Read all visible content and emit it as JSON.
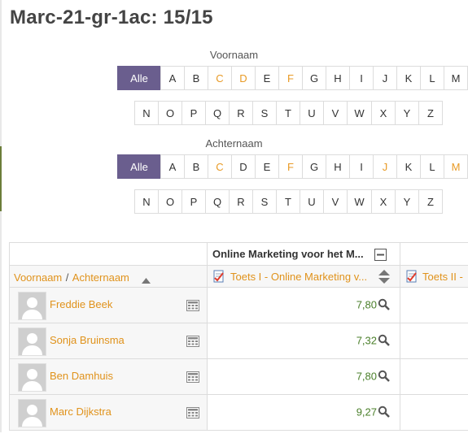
{
  "page": {
    "title": "Marc-21-gr-1ac: 15/15"
  },
  "filters": {
    "firstname_label": "Voornaam",
    "lastname_label": "Achternaam",
    "all_label": "Alle",
    "row1": [
      "A",
      "B",
      "C",
      "D",
      "E",
      "F",
      "G",
      "H",
      "I",
      "J",
      "K",
      "L",
      "M"
    ],
    "row2": [
      "N",
      "O",
      "P",
      "Q",
      "R",
      "S",
      "T",
      "U",
      "V",
      "W",
      "X",
      "Y",
      "Z"
    ],
    "firstname_highlight": [
      "C",
      "D",
      "F"
    ],
    "lastname_highlight": [
      "C",
      "F",
      "J",
      "M"
    ]
  },
  "table": {
    "category_header": "Online Marketing voor het M...",
    "col_firstname": "Voornaam",
    "col_separator": "/",
    "col_lastname": "Achternaam",
    "item1": "Toets I - Online Marketing v...",
    "item2": "Toets II -",
    "students": [
      {
        "name": "Freddie Beek",
        "grade": "7,80"
      },
      {
        "name": "Sonja Bruinsma",
        "grade": "7,32"
      },
      {
        "name": "Ben Damhuis",
        "grade": "7,80"
      },
      {
        "name": "Marc Dijkstra",
        "grade": "9,27"
      }
    ]
  },
  "colors": {
    "accent": "#6a5e8e",
    "link": "#e0921b",
    "grade": "#4a7f2a"
  },
  "icons": [
    "collapse-icon",
    "sort-asc-icon",
    "sort-updown-icon",
    "assignment-icon",
    "magnifier-icon",
    "calculator-icon",
    "avatar-icon"
  ]
}
